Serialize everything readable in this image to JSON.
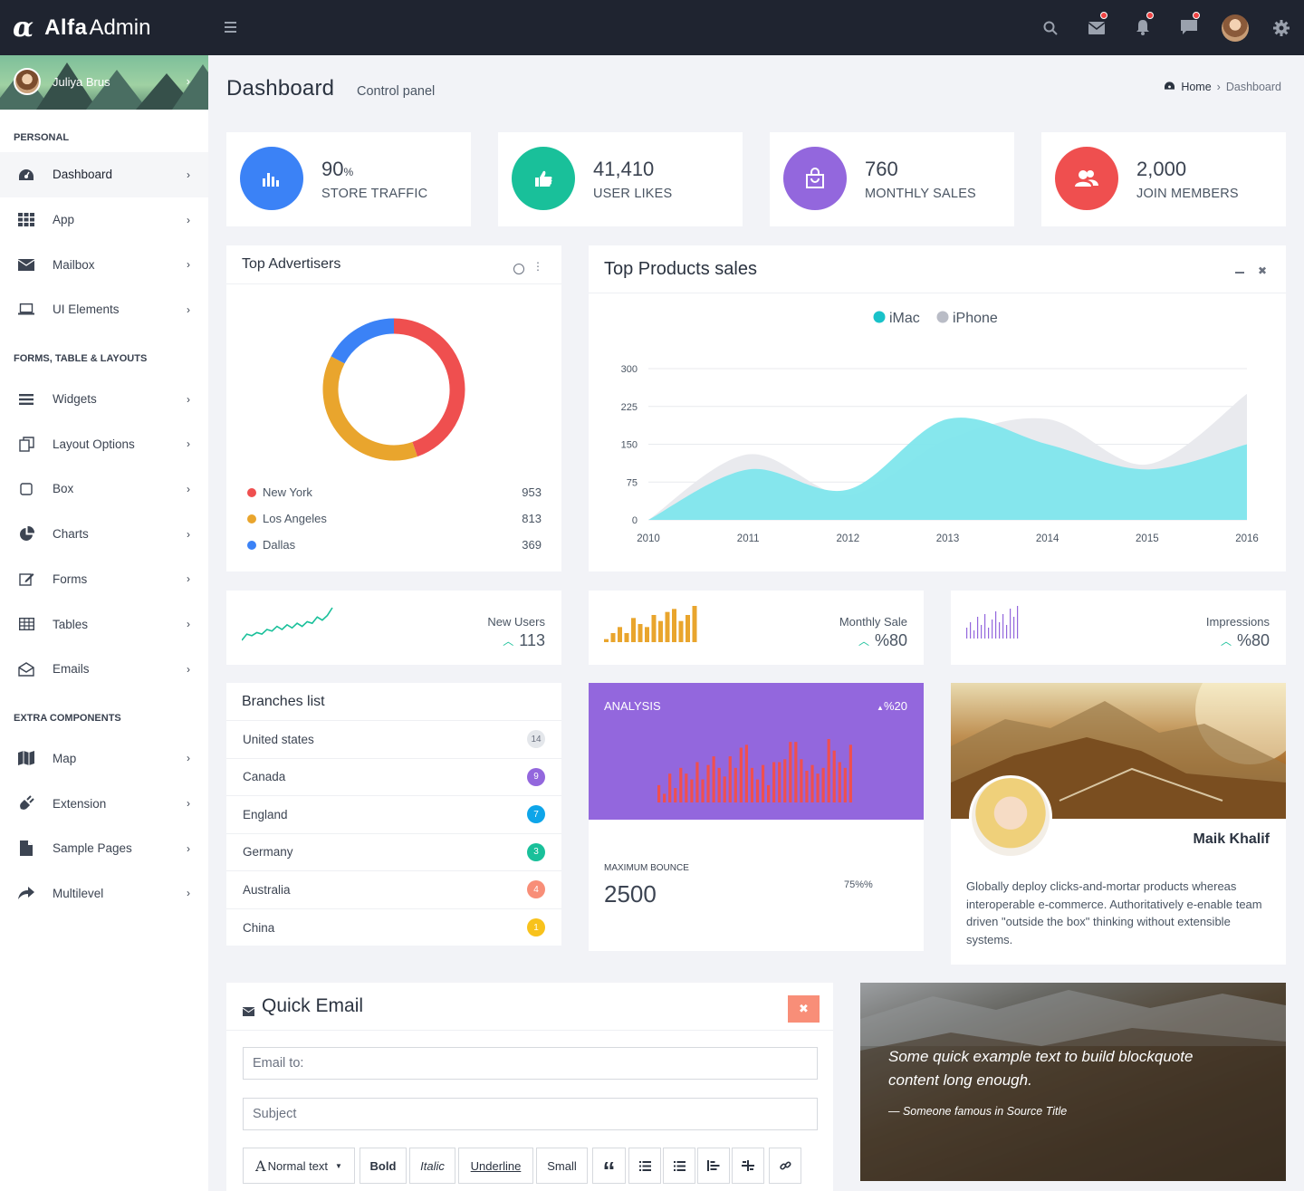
{
  "brand": {
    "symbol": "α",
    "bold": "Alfa",
    "light": "Admin"
  },
  "user": {
    "name": "Juliya Brus"
  },
  "sidebar": {
    "sections": [
      "PERSONAL",
      "FORMS, TABLE & LAYOUTS",
      "EXTRA COMPONENTS"
    ],
    "personal": [
      {
        "label": "Dashboard"
      },
      {
        "label": "App"
      },
      {
        "label": "Mailbox"
      },
      {
        "label": "UI Elements"
      }
    ],
    "forms": [
      {
        "label": "Widgets"
      },
      {
        "label": "Layout Options"
      },
      {
        "label": "Box"
      },
      {
        "label": "Charts"
      },
      {
        "label": "Forms"
      },
      {
        "label": "Tables"
      },
      {
        "label": "Emails"
      }
    ],
    "extra": [
      {
        "label": "Map"
      },
      {
        "label": "Extension"
      },
      {
        "label": "Sample Pages"
      },
      {
        "label": "Multilevel"
      }
    ]
  },
  "header": {
    "title": "Dashboard",
    "subtitle": "Control panel",
    "breadcrumb": [
      "Home",
      "Dashboard"
    ]
  },
  "stats": [
    {
      "value": "90",
      "unit": "%",
      "label": "STORE TRAFFIC",
      "color": "#3b82f6",
      "icon": "bar-chart-icon"
    },
    {
      "value": "41,410",
      "unit": "",
      "label": "USER LIKES",
      "color": "#19c09a",
      "icon": "thumbs-up-icon"
    },
    {
      "value": "760",
      "unit": "",
      "label": "MONTHLY SALES",
      "color": "#9367dd",
      "icon": "shopping-bag-icon"
    },
    {
      "value": "2,000",
      "unit": "",
      "label": "JOIN MEMBERS",
      "color": "#ef4f4f",
      "icon": "users-icon"
    }
  ],
  "advertisers": {
    "title": "Top Advertisers",
    "items": [
      {
        "name": "New York",
        "value": "953",
        "color": "#ef4f4f"
      },
      {
        "name": "Los Angeles",
        "value": "813",
        "color": "#e9a52d"
      },
      {
        "name": "Dallas",
        "value": "369",
        "color": "#3b82f6"
      }
    ]
  },
  "products": {
    "title": "Top Products sales"
  },
  "mini": [
    {
      "label": "New Users",
      "value": "113"
    },
    {
      "label": "Monthly Sale",
      "value": "%80"
    },
    {
      "label": "Impressions",
      "value": "%80"
    }
  ],
  "branches": {
    "title": "Branches list",
    "items": [
      {
        "name": "United states",
        "count": "14",
        "color": "#e4e7eb",
        "text": "#6b7280"
      },
      {
        "name": "Canada",
        "count": "9",
        "color": "#9367dd",
        "text": "#ffffff"
      },
      {
        "name": "England",
        "count": "7",
        "color": "#0ea5e9",
        "text": "#ffffff"
      },
      {
        "name": "Germany",
        "count": "3",
        "color": "#19c09a",
        "text": "#ffffff"
      },
      {
        "name": "Australia",
        "count": "4",
        "color": "#f88e78",
        "text": "#ffffff"
      },
      {
        "name": "China",
        "count": "1",
        "color": "#f8c21c",
        "text": "#ffffff"
      }
    ]
  },
  "analysis": {
    "title": "ANALYSIS",
    "change": "%20",
    "bounce_label": "MAXIMUM BOUNCE",
    "bounce_value": "2500",
    "bounce_pct": "75%%"
  },
  "profile": {
    "name": "Maik Khalif",
    "text": "Globally deploy clicks-and-mortar products whereas interoperable e-commerce. Authoritatively e-enable team driven \"outside the box\" thinking without extensible systems."
  },
  "quick_email": {
    "title": "Quick Email",
    "email_placeholder": "Email to:",
    "subject_placeholder": "Subject",
    "toolbar": {
      "normal": "Normal text",
      "bold": "Bold",
      "italic": "Italic",
      "underline": "Underline",
      "small": "Small",
      "quote": "“"
    }
  },
  "blockquote": {
    "text": "Some quick example text to build blockquote content long enough.",
    "author": "— Someone famous in Source Title"
  },
  "chart_data": [
    {
      "type": "pie",
      "title": "Top Advertisers",
      "categories": [
        "New York",
        "Los Angeles",
        "Dallas"
      ],
      "values": [
        953,
        813,
        369
      ],
      "colors": [
        "#ef4f4f",
        "#e9a52d",
        "#3b82f6"
      ]
    },
    {
      "type": "area",
      "title": "Top Products sales",
      "x": [
        "2010",
        "2011",
        "2012",
        "2013",
        "2014",
        "2015",
        "2016"
      ],
      "ylim": [
        0,
        300
      ],
      "yticks": [
        0,
        75,
        150,
        225,
        300
      ],
      "legend": "top-center",
      "series": [
        {
          "name": "iMac",
          "color": "#7fe6ec",
          "values": [
            0,
            100,
            60,
            200,
            150,
            100,
            150
          ]
        },
        {
          "name": "iPhone",
          "color": "#e9eaee",
          "values": [
            0,
            130,
            50,
            160,
            200,
            110,
            250
          ]
        }
      ]
    },
    {
      "type": "line",
      "title": "New Users",
      "values": [
        5,
        9,
        8,
        10,
        9,
        12,
        11,
        14,
        12,
        15,
        13,
        16,
        14,
        17,
        16,
        20,
        18,
        21,
        26
      ]
    },
    {
      "type": "bar",
      "title": "Monthly Sale",
      "values": [
        1,
        3,
        5,
        3,
        8,
        6,
        5,
        9,
        7,
        10,
        11,
        7,
        9,
        12
      ]
    },
    {
      "type": "bar",
      "title": "Impressions",
      "values": [
        4,
        6,
        3,
        8,
        5,
        9,
        4,
        7,
        10,
        6,
        9,
        5,
        11,
        8,
        12
      ]
    },
    {
      "type": "bar",
      "title": "ANALYSIS",
      "values": [
        6,
        3,
        10,
        5,
        12,
        10,
        8,
        14,
        8,
        13,
        16,
        12,
        9,
        16,
        12,
        19,
        20,
        12,
        8,
        13,
        6,
        14,
        14,
        15,
        21,
        21,
        15,
        11,
        13,
        10,
        12,
        22,
        18,
        14,
        12,
        20
      ]
    }
  ]
}
